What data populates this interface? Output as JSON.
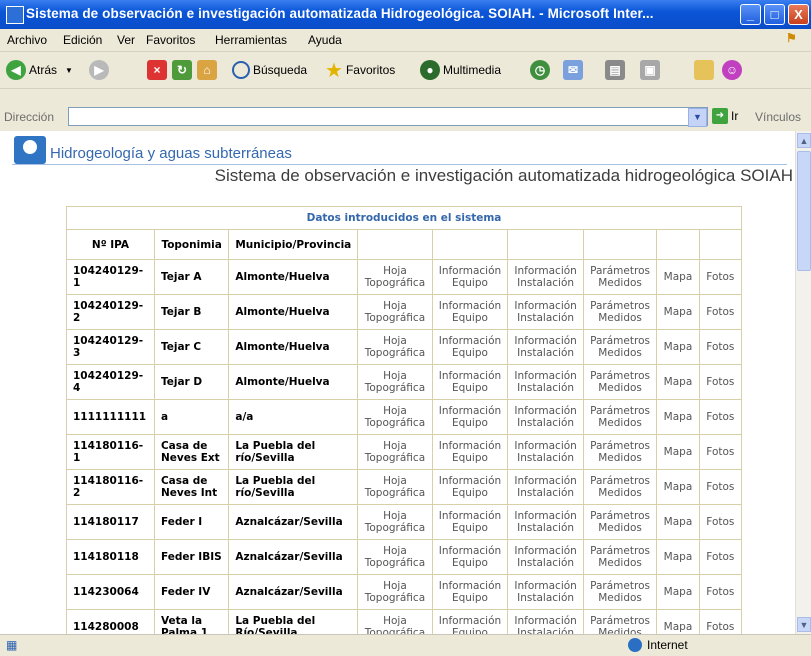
{
  "window": {
    "title": "Sistema de observación e investigación automatizada Hidrogeológica. SOIAH. - Microsoft Inter...",
    "buttons": [
      "_",
      "□",
      "X"
    ]
  },
  "menu": [
    "Archivo",
    "Edición",
    "Ver",
    "Favoritos",
    "Herramientas",
    "Ayuda"
  ],
  "toolbar": {
    "back": "Atrás",
    "search": "Búsqueda",
    "favorites": "Favoritos",
    "multimedia": "Multimedia"
  },
  "address": {
    "label": "Dirección",
    "value": "",
    "go": "Ir",
    "links": "Vínculos"
  },
  "page": {
    "site_title": "Hidrogeología y aguas subterráneas",
    "subtitle": "Sistema de observación e investigación automatizada hidrogeológica SOIAH",
    "table_caption": "Datos introducidos en el sistema",
    "headers": [
      "Nº IPA",
      "Toponimia",
      "Municipio/Provincia",
      "",
      "",
      "",
      "",
      "",
      ""
    ],
    "link_labels": {
      "hoja": "Hoja Topográfica",
      "info_equipo": "Información Equipo",
      "info_instalacion": "Información Instalación",
      "parametros": "Parámetros Medidos",
      "mapa": "Mapa",
      "fotos": "Fotos"
    },
    "rows": [
      {
        "ipa": "104240129-1",
        "toponimia": "Tejar A",
        "municipio": "Almonte/Huelva"
      },
      {
        "ipa": "104240129-2",
        "toponimia": "Tejar B",
        "municipio": "Almonte/Huelva"
      },
      {
        "ipa": "104240129-3",
        "toponimia": "Tejar C",
        "municipio": "Almonte/Huelva"
      },
      {
        "ipa": "104240129-4",
        "toponimia": "Tejar D",
        "municipio": "Almonte/Huelva"
      },
      {
        "ipa": "1111111111",
        "toponimia": "a",
        "municipio": "a/a"
      },
      {
        "ipa": "114180116-1",
        "toponimia": "Casa de Neves Ext",
        "municipio": "La Puebla del río/Sevilla"
      },
      {
        "ipa": "114180116-2",
        "toponimia": "Casa de Neves Int",
        "municipio": "La Puebla del río/Sevilla"
      },
      {
        "ipa": "114180117",
        "toponimia": "Feder I",
        "municipio": "Aznalcázar/Sevilla"
      },
      {
        "ipa": "114180118",
        "toponimia": "Feder IBIS",
        "municipio": "Aznalcázar/Sevilla"
      },
      {
        "ipa": "114230064",
        "toponimia": "Feder IV",
        "municipio": "Aznalcázar/Sevilla"
      },
      {
        "ipa": "114280008",
        "toponimia": "Veta la Palma 1",
        "municipio": "La Puebla del Río/Sevilla"
      }
    ]
  },
  "status": {
    "zone": "Internet"
  }
}
